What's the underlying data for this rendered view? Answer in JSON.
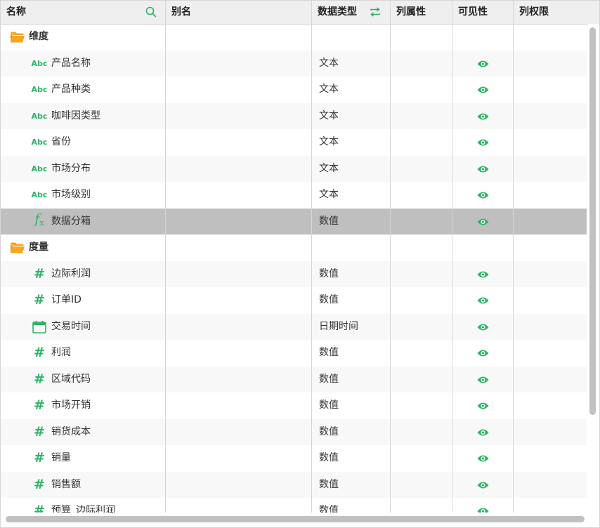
{
  "header": {
    "name": "名称",
    "alias": "别名",
    "data_type": "数据类型",
    "column_attr": "列属性",
    "visibility": "可见性",
    "column_perm": "列权限"
  },
  "colors": {
    "accent": "#2fb368",
    "folder": "#f5a623",
    "selected_row": "#bfbfbf",
    "header_bg": "#efefef"
  },
  "rows": [
    {
      "kind": "folder",
      "name": "维度",
      "type": "",
      "visible": false,
      "icon": "folder-icon"
    },
    {
      "kind": "field",
      "icon": "abc-text-icon",
      "name": "产品名称",
      "type": "文本",
      "visible": true
    },
    {
      "kind": "field",
      "icon": "abc-text-icon",
      "name": "产品种类",
      "type": "文本",
      "visible": true
    },
    {
      "kind": "field",
      "icon": "abc-text-icon",
      "name": "咖啡因类型",
      "type": "文本",
      "visible": true
    },
    {
      "kind": "field",
      "icon": "abc-text-icon",
      "name": "省份",
      "type": "文本",
      "visible": true
    },
    {
      "kind": "field",
      "icon": "abc-text-icon",
      "name": "市场分布",
      "type": "文本",
      "visible": true
    },
    {
      "kind": "field",
      "icon": "abc-text-icon",
      "name": "市场级别",
      "type": "文本",
      "visible": true
    },
    {
      "kind": "field",
      "icon": "fx-function-icon",
      "name": "数据分箱",
      "type": "数值",
      "visible": true,
      "selected": true
    },
    {
      "kind": "folder",
      "name": "度量",
      "type": "",
      "visible": false,
      "icon": "folder-icon"
    },
    {
      "kind": "field",
      "icon": "hash-number-icon",
      "name": "边际利润",
      "type": "数值",
      "visible": true
    },
    {
      "kind": "field",
      "icon": "hash-number-icon",
      "name": "订单ID",
      "type": "数值",
      "visible": true
    },
    {
      "kind": "field",
      "icon": "calendar-icon",
      "name": "交易时间",
      "type": "日期时间",
      "visible": true
    },
    {
      "kind": "field",
      "icon": "hash-number-icon",
      "name": "利润",
      "type": "数值",
      "visible": true
    },
    {
      "kind": "field",
      "icon": "hash-number-icon",
      "name": "区域代码",
      "type": "数值",
      "visible": true
    },
    {
      "kind": "field",
      "icon": "hash-number-icon",
      "name": "市场开销",
      "type": "数值",
      "visible": true
    },
    {
      "kind": "field",
      "icon": "hash-number-icon",
      "name": "销货成本",
      "type": "数值",
      "visible": true
    },
    {
      "kind": "field",
      "icon": "hash-number-icon",
      "name": "销量",
      "type": "数值",
      "visible": true
    },
    {
      "kind": "field",
      "icon": "hash-number-icon",
      "name": "销售额",
      "type": "数值",
      "visible": true
    },
    {
      "kind": "field",
      "icon": "hash-number-icon",
      "name": "预算_边际利润",
      "type": "数值",
      "visible": true
    }
  ]
}
